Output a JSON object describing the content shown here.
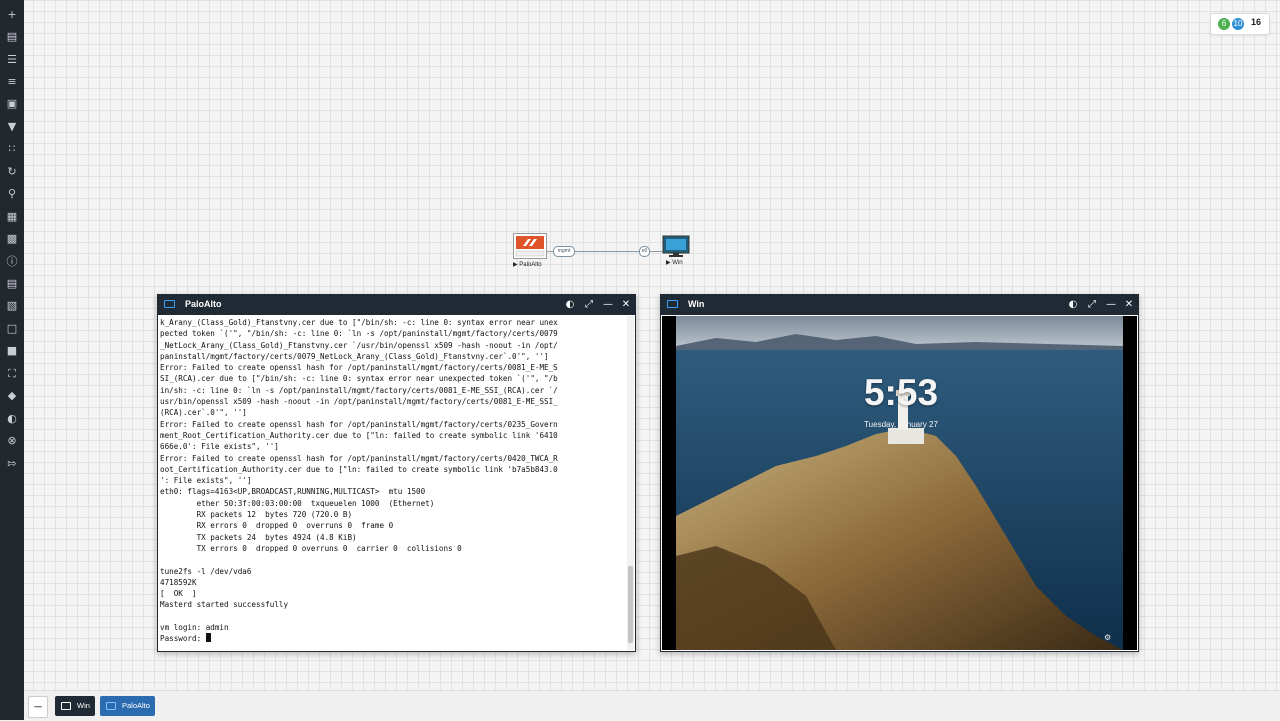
{
  "sidebar": {
    "icons": [
      "plus-icon",
      "node-icon",
      "network-icon",
      "text-icon",
      "object-icon",
      "filter-icon",
      "grid-icon",
      "refresh-icon",
      "search-icon",
      "map-icon",
      "image-icon",
      "info-icon",
      "document-icon",
      "clipboard-icon",
      "chat-icon",
      "lock-icon",
      "fullscreen-icon",
      "tag-icon",
      "theme-icon",
      "close-circle-icon",
      "logout-icon"
    ]
  },
  "status": {
    "green": "6",
    "blue": "10",
    "total": "16"
  },
  "topology": {
    "paloalto_label": "PaloAlto",
    "win_label": "Win",
    "link_left": "mgmt",
    "link_right": "e0"
  },
  "paloalto_window": {
    "title": "PaloAlto",
    "lines": [
      "k_Arany_(Class_Gold)_Ftanstvny.cer due to [\"/bin/sh: -c: line 0: syntax error near unex",
      "pected token `('\", \"/bin/sh: -c: line 0: `ln -s /opt/paninstall/mgmt/factory/certs/0079",
      "_NetLock_Arany_(Class_Gold)_Ftanstvny.cer `/usr/bin/openssl x509 -hash -noout -in /opt/",
      "paninstall/mgmt/factory/certs/0079_NetLock_Arany_(Class_Gold)_Ftanstvny.cer`.0'\", '']",
      "Error: Failed to create openssl hash for /opt/paninstall/mgmt/factory/certs/0081_E-ME_S",
      "SI_(RCA).cer due to [\"/bin/sh: -c: line 0: syntax error near unexpected token `('\", \"/b",
      "in/sh: -c: line 0: `ln -s /opt/paninstall/mgmt/factory/certs/0081_E-ME_SSI_(RCA).cer `/",
      "usr/bin/openssl x509 -hash -noout -in /opt/paninstall/mgmt/factory/certs/0081_E-ME_SSI_",
      "(RCA).cer`.0'\", '']",
      "Error: Failed to create openssl hash for /opt/paninstall/mgmt/factory/certs/0235_Govern",
      "ment_Root_Certification_Authority.cer due to [\"ln: failed to create symbolic link '6410",
      "666e.0': File exists\", '']",
      "Error: Failed to create openssl hash for /opt/paninstall/mgmt/factory/certs/0420_TWCA_R",
      "oot_Certification_Authority.cer due to [\"ln: failed to create symbolic link 'b7a5b843.0",
      "': File exists\", '']",
      "eth0: flags=4163<UP,BROADCAST,RUNNING,MULTICAST>  mtu 1500",
      "        ether 50:3f:00:03:00:00  txqueuelen 1000  (Ethernet)",
      "        RX packets 12  bytes 720 (720.0 B)",
      "        RX errors 0  dropped 0  overruns 0  frame 0",
      "        TX packets 24  bytes 4924 (4.8 KiB)",
      "        TX errors 0  dropped 0 overruns 0  carrier 0  collisions 0",
      "",
      "tune2fs -l /dev/vda6",
      "4718592K",
      "[  OK  ]",
      "Masterd started successfully",
      "",
      "vm login: admin"
    ],
    "prompt": "Password: "
  },
  "win_window": {
    "title": "Win",
    "time": "5:53",
    "date": "Tuesday, January 27"
  },
  "taskbar": {
    "items": [
      {
        "label": "Win"
      },
      {
        "label": "PaloAlto"
      }
    ]
  },
  "colors": {
    "accent": "#3aa0ff",
    "sidebar": "#23272e",
    "titlebar": "#1f2a35",
    "green": "#4caf50",
    "blue": "#2f8fd6",
    "paloalto_orange": "#e0542a"
  }
}
